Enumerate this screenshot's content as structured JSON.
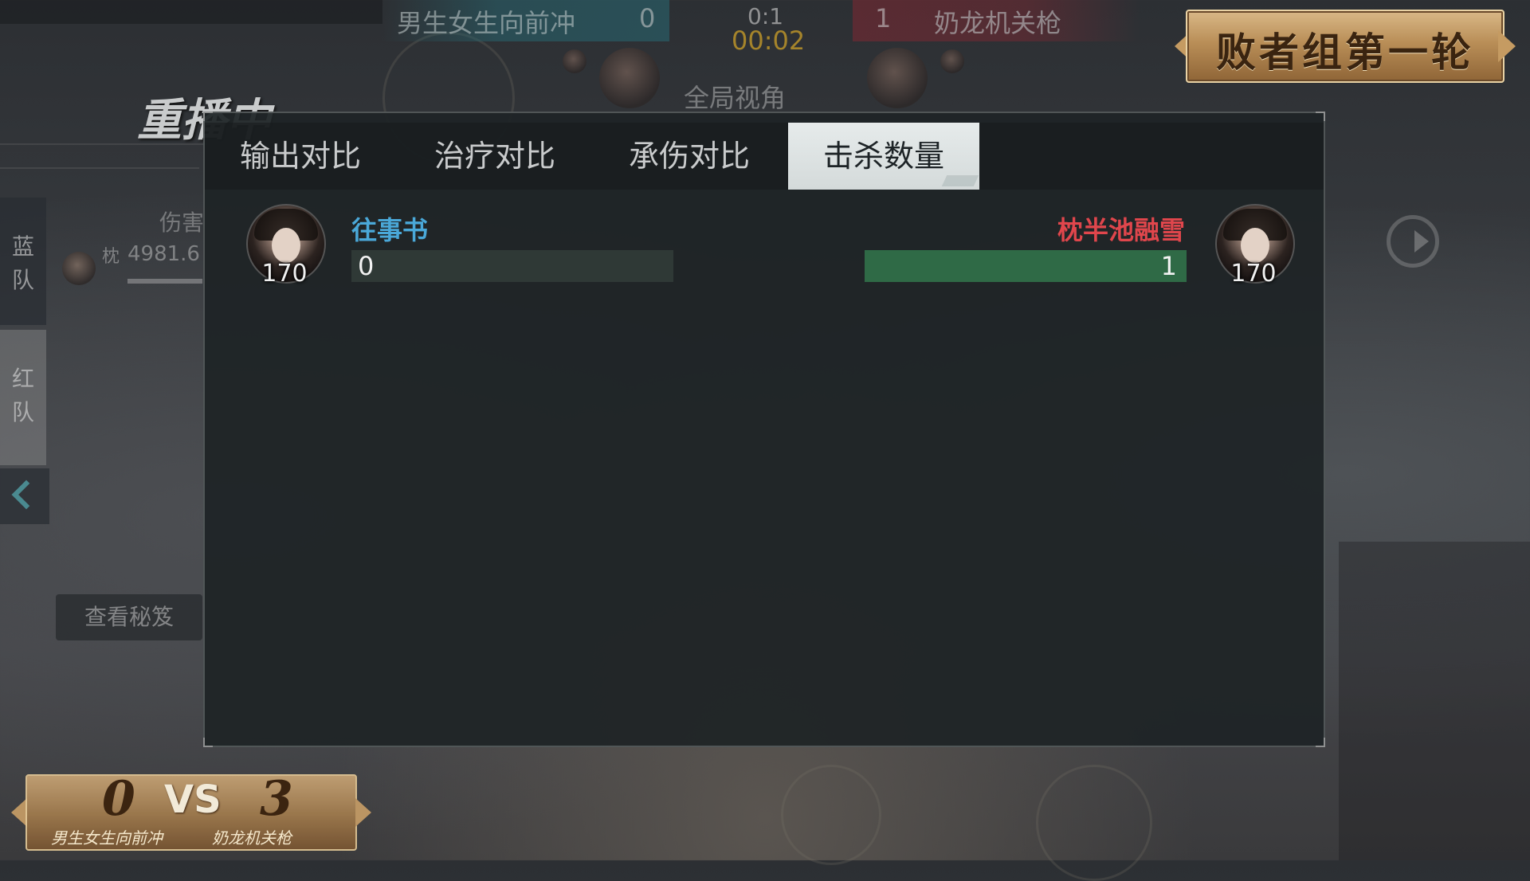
{
  "top_bar": {
    "blue_team": "男生女生向前冲",
    "blue_score": "0",
    "ratio": "0:1",
    "timer": "00:02",
    "red_score": "1",
    "red_team": "奶龙机关枪",
    "global_view": "全局视角"
  },
  "round_banner": "败者组第一轮",
  "replay_label": "重播中",
  "side_panel": {
    "blue_label_1": "蓝",
    "blue_label_2": "队",
    "red_label_1": "红",
    "red_label_2": "队",
    "damage_header": "伤害",
    "damage_tag": "枕",
    "damage_value": "4981.6",
    "view_secrets": "查看秘笈"
  },
  "tabs": [
    {
      "label": "输出对比",
      "active": false
    },
    {
      "label": "治疗对比",
      "active": false
    },
    {
      "label": "承伤对比",
      "active": false
    },
    {
      "label": "击杀数量",
      "active": true
    }
  ],
  "comparison": {
    "left_player": {
      "name": "往事书",
      "level": "170",
      "value": "0",
      "fraction": 0
    },
    "right_player": {
      "name": "枕半池融雪",
      "level": "170",
      "value": "1",
      "fraction": 1
    }
  },
  "score_plaque": {
    "left_score": "0",
    "vs": "VS",
    "right_score": "3",
    "left_team": "男生女生向前冲",
    "right_team": "奶龙机关枪"
  },
  "colors": {
    "blue_name": "#4aa8d8",
    "red_name": "#e0464c",
    "bar_fill": "#2f6a46",
    "timer": "#cda028"
  },
  "icons": [
    "exit-icon",
    "back-arrow-icon",
    "avatar"
  ]
}
